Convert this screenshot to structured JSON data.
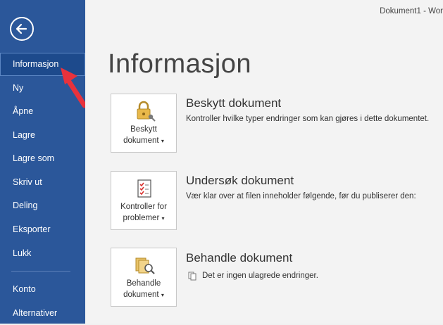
{
  "window": {
    "title": "Dokument1  -  Wor"
  },
  "sidebar": {
    "items": [
      {
        "label": "Informasjon"
      },
      {
        "label": "Ny"
      },
      {
        "label": "Åpne"
      },
      {
        "label": "Lagre"
      },
      {
        "label": "Lagre som"
      },
      {
        "label": "Skriv ut"
      },
      {
        "label": "Deling"
      },
      {
        "label": "Eksporter"
      },
      {
        "label": "Lukk"
      },
      {
        "label": "Konto"
      },
      {
        "label": "Alternativer"
      }
    ]
  },
  "main": {
    "title": "Informasjon",
    "sections": [
      {
        "tile_label": "Beskytt\ndokument",
        "heading": "Beskytt dokument",
        "description": "Kontroller hvilke typer endringer som kan gjøres i dette dokumentet."
      },
      {
        "tile_label": "Kontroller for\nproblemer",
        "heading": "Undersøk dokument",
        "description": "Vær klar over at filen inneholder følgende, før du publiserer den:"
      },
      {
        "tile_label": "Behandle\ndokument",
        "heading": "Behandle dokument",
        "description": "Det er ingen ulagrede endringer."
      }
    ]
  },
  "colors": {
    "sidebar": "#2b579a",
    "annotation_arrow": "#e8323c"
  },
  "icons": {
    "back": "back-arrow-icon",
    "protect": "lock-key-icon",
    "inspect": "checklist-icon",
    "manage": "document-search-icon",
    "no_changes": "document-small-icon"
  }
}
